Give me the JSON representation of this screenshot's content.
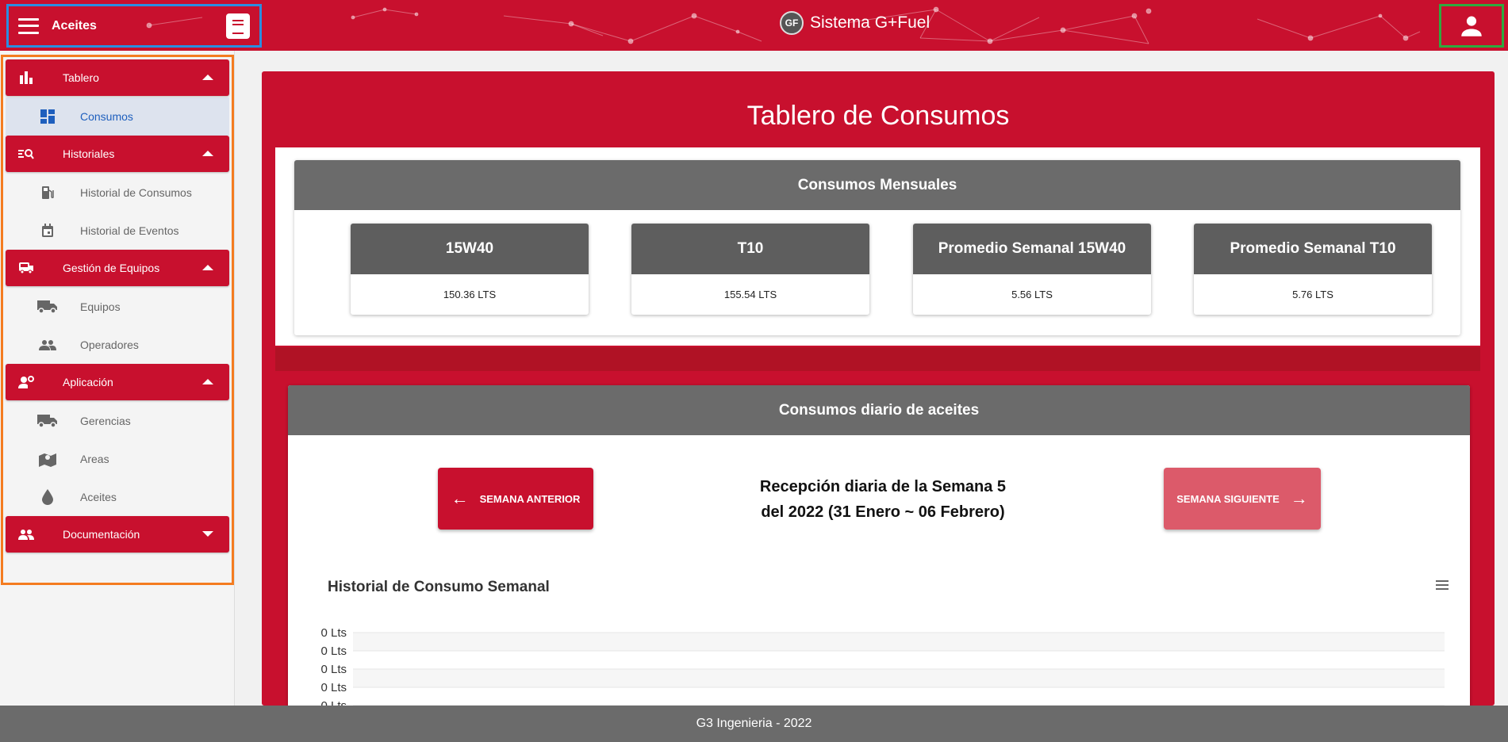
{
  "header": {
    "brand": "Aceites",
    "app_title": "Sistema G+Fuel",
    "logo_text": "GF"
  },
  "sidebar": {
    "sections": [
      {
        "label": "Tablero",
        "icon": "bar-chart-icon",
        "expanded": true,
        "items": [
          {
            "label": "Consumos",
            "icon": "dashboard-icon",
            "active": true
          }
        ]
      },
      {
        "label": "Historiales",
        "icon": "search-list-icon",
        "expanded": true,
        "items": [
          {
            "label": "Historial de Consumos",
            "icon": "fuel-pump-icon"
          },
          {
            "label": "Historial de Eventos",
            "icon": "calendar-icon"
          }
        ]
      },
      {
        "label": "Gestión de Equipos",
        "icon": "bus-icon",
        "expanded": true,
        "items": [
          {
            "label": "Equipos",
            "icon": "truck-icon"
          },
          {
            "label": "Operadores",
            "icon": "people-icon"
          }
        ]
      },
      {
        "label": "Aplicación",
        "icon": "user-settings-icon",
        "expanded": true,
        "items": [
          {
            "label": "Gerencias",
            "icon": "truck-icon"
          },
          {
            "label": "Areas",
            "icon": "map-pin-icon"
          },
          {
            "label": "Aceites",
            "icon": "drop-icon"
          }
        ]
      },
      {
        "label": "Documentación",
        "icon": "people-icon",
        "expanded": false,
        "items": []
      }
    ]
  },
  "main": {
    "title": "Tablero de Consumos",
    "monthly": {
      "title": "Consumos Mensuales",
      "stats": [
        {
          "label": "15W40",
          "value": "150.36 LTS"
        },
        {
          "label": "T10",
          "value": "155.54 LTS"
        },
        {
          "label": "Promedio Semanal 15W40",
          "value": "5.56 LTS"
        },
        {
          "label": "Promedio Semanal T10",
          "value": "5.76 LTS"
        }
      ]
    },
    "daily": {
      "title": "Consumos diario de aceites",
      "prev_label": "SEMANA ANTERIOR",
      "next_label": "SEMANA SIGUIENTE",
      "week_line1": "Recepción diaria de la Semana 5",
      "week_line2": "del 2022 (31 Enero ~ 06 Febrero)"
    }
  },
  "chart_data": {
    "type": "bar",
    "title": "Historial de Consumo Semanal",
    "y_tick_labels": [
      "0 Lts",
      "0 Lts",
      "0 Lts",
      "0 Lts",
      "0 Lts"
    ],
    "series": [],
    "grid": true
  },
  "footer": {
    "text": "G3 Ingenieria - 2022"
  },
  "colors": {
    "primary": "#c8102e",
    "header_gray": "#6b6b6b",
    "active_bg": "#dde3ee",
    "active_text": "#1e5fbd",
    "next_button": "#dc5a6a"
  }
}
